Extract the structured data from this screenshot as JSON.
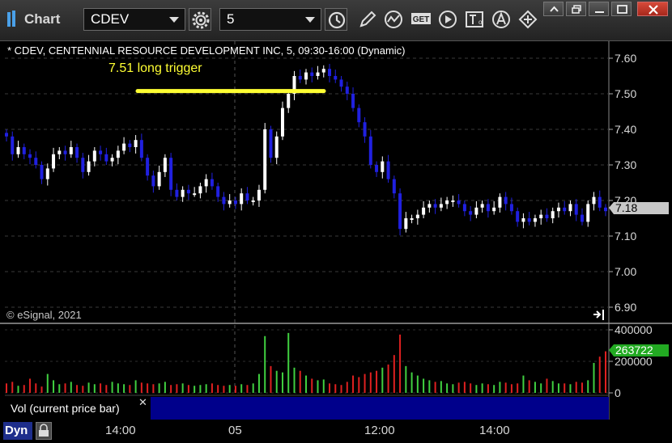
{
  "app": {
    "title": "Chart",
    "symbol": "CDEV",
    "interval": "5"
  },
  "chart_header": "* CDEV, CENTENNIAL RESOURCE DEVELOPMENT INC, 5, 09:30-16:00 (Dynamic)",
  "annotation": {
    "text": "7.51 long trigger",
    "color": "#ffff33",
    "level": 7.51
  },
  "credit": "© eSignal, 2021",
  "last_price_label": "7.18",
  "volume": {
    "label": "Vol (current price bar)",
    "current_label": "263722",
    "ticks": [
      "400000",
      "200000",
      "0"
    ]
  },
  "bottom": {
    "dyn_label": "Dyn"
  },
  "colors": {
    "up": "#ffffff",
    "down": "#2020e0",
    "vol_up": "#40d040",
    "vol_down": "#e02020",
    "volume_badge": "#22aa22"
  },
  "icons": [
    "chart-logo-icon",
    "settings-gear-icon",
    "clock-icon",
    "pencil-icon",
    "line-draw-icon",
    "get-icon",
    "play-icon",
    "text-tool-icon",
    "alert-icon",
    "link-icon",
    "collapse-icon",
    "restore-icon",
    "maximize-icon",
    "close-icon"
  ],
  "chart_data": {
    "type": "candlestick",
    "title": "* CDEV, CENTENNIAL RESOURCE DEVELOPMENT INC, 5, 09:30-16:00 (Dynamic)",
    "ylim": [
      6.87,
      7.64
    ],
    "y_ticks": [
      "7.60",
      "7.50",
      "7.40",
      "7.30",
      "7.20",
      "7.10",
      "7.00",
      "6.90"
    ],
    "x_ticks": [
      "14:00",
      "05",
      "12:00",
      "14:00"
    ],
    "last_price": 7.18,
    "horizontal_line": 7.51,
    "closes": [
      7.38,
      7.33,
      7.35,
      7.33,
      7.32,
      7.3,
      7.26,
      7.29,
      7.33,
      7.34,
      7.33,
      7.35,
      7.32,
      7.28,
      7.31,
      7.34,
      7.33,
      7.31,
      7.32,
      7.34,
      7.36,
      7.35,
      7.37,
      7.32,
      7.27,
      7.24,
      7.28,
      7.32,
      7.23,
      7.21,
      7.23,
      7.22,
      7.22,
      7.24,
      7.26,
      7.24,
      7.21,
      7.19,
      7.2,
      7.19,
      7.22,
      7.2,
      7.2,
      7.23,
      7.4,
      7.32,
      7.38,
      7.46,
      7.5,
      7.55,
      7.54,
      7.56,
      7.55,
      7.56,
      7.57,
      7.55,
      7.54,
      7.52,
      7.5,
      7.46,
      7.42,
      7.38,
      7.3,
      7.28,
      7.31,
      7.26,
      7.22,
      7.12,
      7.15,
      7.15,
      7.16,
      7.18,
      7.19,
      7.18,
      7.19,
      7.2,
      7.2,
      7.19,
      7.17,
      7.16,
      7.18,
      7.19,
      7.17,
      7.18,
      7.21,
      7.19,
      7.17,
      7.14,
      7.15,
      7.14,
      7.15,
      7.16,
      7.15,
      7.17,
      7.18,
      7.17,
      7.19,
      7.16,
      7.14,
      7.19,
      7.21,
      7.18,
      7.17
    ],
    "volumes": [
      60000,
      70000,
      45000,
      50000,
      90000,
      60000,
      40000,
      120000,
      80000,
      55000,
      60000,
      70000,
      50000,
      45000,
      65000,
      55000,
      60000,
      50000,
      70000,
      60000,
      55000,
      50000,
      80000,
      65000,
      60000,
      55000,
      60000,
      70000,
      50000,
      55000,
      60000,
      50000,
      45000,
      50000,
      55000,
      60000,
      50000,
      45000,
      50000,
      45000,
      55000,
      50000,
      60000,
      120000,
      360000,
      170000,
      140000,
      130000,
      380000,
      160000,
      140000,
      110000,
      90000,
      80000,
      85000,
      60000,
      55000,
      50000,
      70000,
      110000,
      100000,
      120000,
      130000,
      140000,
      160000,
      180000,
      240000,
      370000,
      170000,
      130000,
      110000,
      90000,
      80000,
      70000,
      75000,
      60000,
      55000,
      65000,
      70000,
      60000,
      50000,
      60000,
      55000,
      50000,
      70000,
      65000,
      55000,
      60000,
      110000,
      80000,
      70000,
      60000,
      90000,
      75000,
      60000,
      60000,
      55000,
      70000,
      65000,
      80000,
      190000,
      230000,
      263722
    ]
  }
}
